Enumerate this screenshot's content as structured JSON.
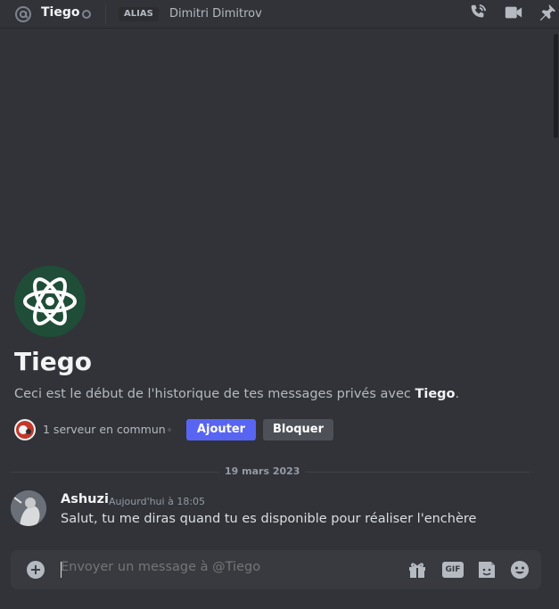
{
  "header": {
    "name": "Tiego",
    "alias_label": "ALIAS",
    "alias_value": "Dimitri Dimitrov",
    "icons": [
      "at-icon",
      "call-icon",
      "video-icon",
      "pin-icon"
    ]
  },
  "intro": {
    "name": "Tiego",
    "desc_prefix": "Ceci est le début de l'historique de tes messages privés avec ",
    "desc_name": "Tiego",
    "desc_suffix": ".",
    "mutual_text": "1 serveur en commun",
    "add_label": "Ajouter",
    "block_label": "Bloquer"
  },
  "divider": {
    "date": "19 mars 2023"
  },
  "messages": [
    {
      "author": "Ashuzi",
      "time": "Aujourd'hui à 18:05",
      "text": "Salut, tu me diras quand tu es disponible pour réaliser l'enchère"
    }
  ],
  "composer": {
    "placeholder": "Envoyer un message à @Tiego",
    "gif_label": "GIF",
    "icons": [
      "add-icon",
      "gift-icon",
      "gif-icon",
      "sticker-icon",
      "emoji-icon"
    ]
  },
  "colors": {
    "background": "#313338",
    "accent": "#5865f2",
    "avatar_bg": "#1f4d37"
  }
}
